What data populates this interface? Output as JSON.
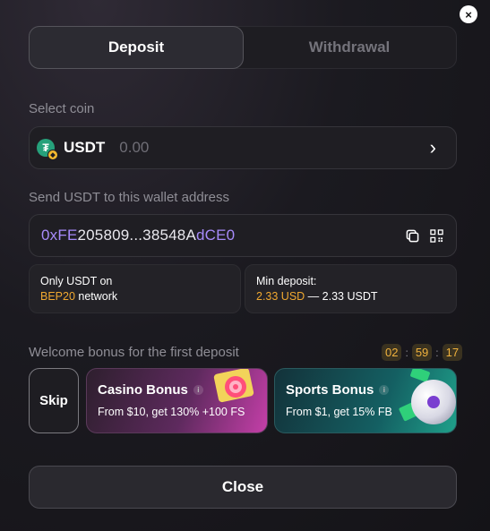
{
  "close_icon": "×",
  "tabs": [
    {
      "label": "Deposit",
      "active": true
    },
    {
      "label": "Withdrawal",
      "active": false
    }
  ],
  "select_coin": {
    "label": "Select coin",
    "coin": "USDT",
    "coin_icon": "tether-icon",
    "coin_icon_glyph": "₮",
    "network_badge_glyph": "◆",
    "amount": "0.00",
    "chevron": "›"
  },
  "wallet": {
    "label": "Send USDT to this wallet address",
    "address_prefix": "0xFE",
    "address_middle": "205809...38548A",
    "address_suffix": "dCE0"
  },
  "info": {
    "network_line1": "Only USDT on",
    "network_name": "BEP20",
    "network_suffix": " network",
    "min_label": "Min deposit:",
    "min_usd": "2.33 USD",
    "min_sep": " — ",
    "min_usdt": "2.33 USDT"
  },
  "bonus": {
    "label": "Welcome bonus for the first deposit",
    "timer": [
      "02",
      "59",
      "17"
    ],
    "timer_sep": ":",
    "skip": "Skip",
    "info_glyph": "i",
    "casino": {
      "title": "Casino Bonus",
      "desc": "From $10, get 130% +100 FS"
    },
    "sports": {
      "title": "Sports Bonus",
      "desc": "From $1, get 15% FB"
    }
  },
  "close_button": "Close",
  "colors": {
    "accent_purple": "#a78bfa",
    "accent_orange": "#f0a830",
    "tether_green": "#26a17b"
  }
}
